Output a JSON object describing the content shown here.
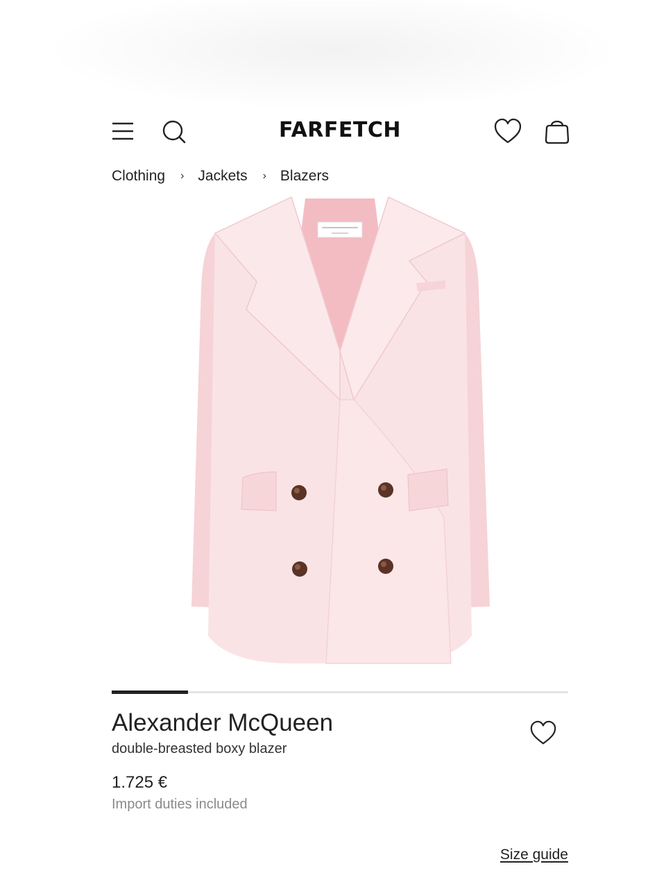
{
  "header": {
    "logo": "FARFETCH",
    "icons": [
      "menu-icon",
      "search-icon",
      "heart-icon",
      "shopping-bag-icon"
    ]
  },
  "breadcrumb": [
    {
      "label": "Clothing"
    },
    {
      "label": "Jackets"
    },
    {
      "label": "Blazers"
    }
  ],
  "breadcrumb_separator": "›",
  "gallery": {
    "image_alt": "pink double-breasted blazer",
    "progress": 0.167,
    "colors": {
      "jacket": "#f9dfe1",
      "lining": "#f3bcc3",
      "button": "#5a3326"
    }
  },
  "product": {
    "brand": "Alexander McQueen",
    "name": "double-breasted boxy blazer",
    "price": "1.725 €",
    "duties_note": "Import duties included",
    "size_guide": "Size guide"
  },
  "colors": {
    "text": "#222222",
    "muted": "#8a8a8a",
    "track": "#e4e4e4",
    "progress": "#222222"
  }
}
